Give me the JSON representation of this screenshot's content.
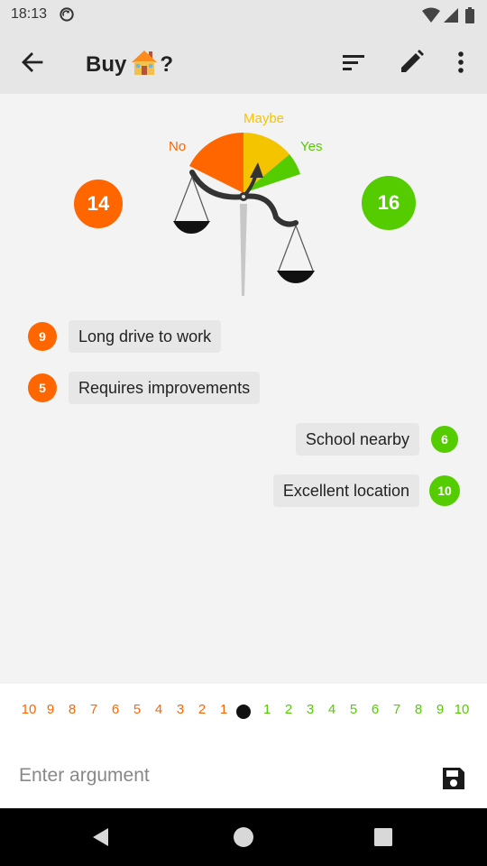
{
  "status_bar": {
    "time": "18:13",
    "icons": [
      "sync-icon",
      "wifi-icon",
      "signal-icon",
      "battery-icon"
    ]
  },
  "app_bar": {
    "title_prefix": "Buy",
    "title_icon": "house-emoji-icon",
    "title_suffix": "?",
    "actions": [
      "sort-icon",
      "edit-icon",
      "more-vert-icon"
    ]
  },
  "decision": {
    "no_score": "14",
    "yes_score": "16",
    "labels": {
      "no": "No",
      "maybe": "Maybe",
      "yes": "Yes"
    },
    "colors": {
      "no": "#ff6600",
      "maybe": "#f5c400",
      "yes": "#55cc00"
    }
  },
  "arguments": [
    {
      "text": "Long drive to work",
      "weight": "9",
      "side": "no"
    },
    {
      "text": "Requires improvements",
      "weight": "5",
      "side": "no"
    },
    {
      "text": "School nearby",
      "weight": "6",
      "side": "yes"
    },
    {
      "text": "Excellent location",
      "weight": "10",
      "side": "yes"
    }
  ],
  "weight_selector": {
    "no": [
      "10",
      "9",
      "8",
      "7",
      "6",
      "5",
      "4",
      "3",
      "2",
      "1"
    ],
    "yes": [
      "1",
      "2",
      "3",
      "4",
      "5",
      "6",
      "7",
      "8",
      "9",
      "10"
    ],
    "selected": "neutral"
  },
  "input": {
    "placeholder": "Enter argument",
    "value": ""
  },
  "nav_bar": [
    "back-triangle-icon",
    "home-circle-icon",
    "recents-square-icon"
  ]
}
